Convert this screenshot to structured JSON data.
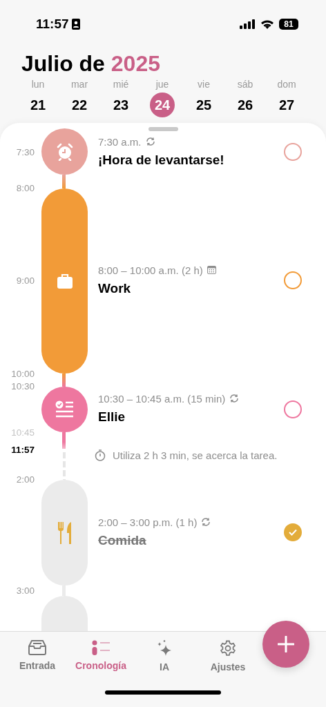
{
  "status_bar": {
    "time": "11:57",
    "battery": "81"
  },
  "header": {
    "month": "Julio de",
    "year": "2025"
  },
  "days": [
    {
      "weekday": "lun",
      "date": "21",
      "selected": false
    },
    {
      "weekday": "mar",
      "date": "22",
      "selected": false
    },
    {
      "weekday": "mié",
      "date": "23",
      "selected": false
    },
    {
      "weekday": "jue",
      "date": "24",
      "selected": true
    },
    {
      "weekday": "vie",
      "date": "25",
      "selected": false
    },
    {
      "weekday": "sáb",
      "date": "26",
      "selected": false
    },
    {
      "weekday": "dom",
      "date": "27",
      "selected": false
    }
  ],
  "time_labels": [
    {
      "text": "7:30",
      "kind": "normal"
    },
    {
      "text": "8:00",
      "kind": "normal"
    },
    {
      "text": "9:00",
      "kind": "normal"
    },
    {
      "text": "10:00",
      "kind": "normal"
    },
    {
      "text": "10:30",
      "kind": "normal"
    },
    {
      "text": "10:45",
      "kind": "faint"
    },
    {
      "text": "11:57",
      "kind": "now"
    },
    {
      "text": "2:00",
      "kind": "normal"
    },
    {
      "text": "3:00",
      "kind": "normal"
    }
  ],
  "events": [
    {
      "kind": "alarm",
      "time": "7:30 a.m.",
      "recurring": true,
      "title": "¡Hora de levantarse!",
      "color": "#e8a39c",
      "done": false
    },
    {
      "kind": "work",
      "time": "8:00 – 10:00 a.m. (2 h)",
      "recurring": false,
      "title": "Work",
      "color": "#f29b38",
      "done": false
    },
    {
      "kind": "checklist",
      "time": "10:30 – 10:45 a.m. (15 min)",
      "recurring": true,
      "title": "Ellie",
      "color": "#ee779f",
      "done": false
    },
    {
      "kind": "meal",
      "time": "2:00 – 3:00 p.m. (1 h)",
      "recurring": true,
      "title": "Comida",
      "color": "#e3ac3a",
      "done": true
    }
  ],
  "note": "Utiliza 2 h 3 min, se acerca la tarea.",
  "tabs": [
    {
      "label": "Entrada",
      "selected": false
    },
    {
      "label": "Cronología",
      "selected": true
    },
    {
      "label": "IA",
      "selected": false
    },
    {
      "label": "Ajustes",
      "selected": false
    }
  ]
}
